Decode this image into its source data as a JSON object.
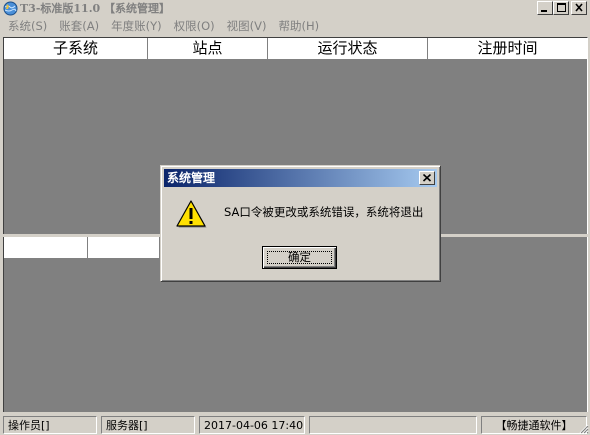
{
  "window": {
    "title": "T3-标准版11.0 【系统管理】",
    "icons": {
      "app": "app-globe-icon",
      "minimize": "minimize-icon",
      "maximize": "maximize-icon",
      "close": "close-icon"
    }
  },
  "menu": {
    "items": [
      {
        "label": "系统(S)"
      },
      {
        "label": "账套(A)"
      },
      {
        "label": "年度账(Y)"
      },
      {
        "label": "权限(O)"
      },
      {
        "label": "视图(V)"
      },
      {
        "label": "帮助(H)"
      }
    ]
  },
  "grid": {
    "columns": [
      "子系统",
      "站点",
      "运行状态",
      "注册时间"
    ]
  },
  "statusbar": {
    "operator": "操作员[]",
    "server": "服务器[]",
    "datetime": "2017-04-06 17:40",
    "brand": "【畅捷通软件】"
  },
  "dialog": {
    "title": "系统管理",
    "message": "SA口令被更改或系统错误，系统将退出",
    "ok_label": "确定",
    "icon": "warning-icon"
  },
  "colors": {
    "desktop_gray": "#808080",
    "face": "#d4d0c8",
    "dialog_title_start": "#0a246a",
    "dialog_title_end": "#a6caf0",
    "warning_yellow": "#ffe000"
  }
}
